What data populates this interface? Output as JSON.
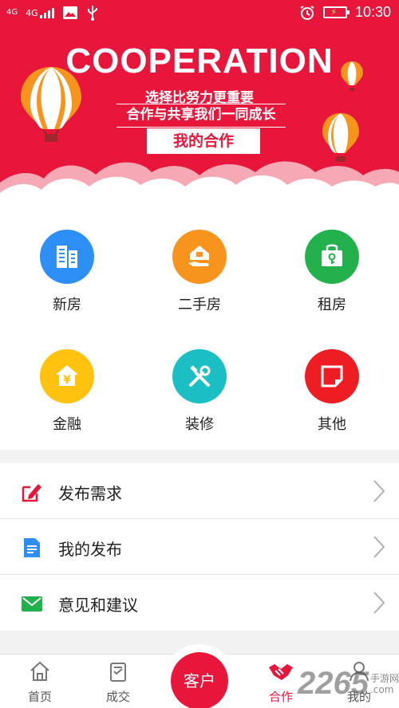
{
  "status_bar": {
    "network_top": "4G",
    "network_main": "4G",
    "time": "10:30",
    "icons": [
      "signal-icon",
      "image-icon",
      "usb-icon",
      "alarm-icon",
      "battery-charging-icon"
    ]
  },
  "banner": {
    "title": "COOPERATION",
    "line1": "选择比努力更重要",
    "line2": "合作与共享我们一同成长",
    "button": "我的合作",
    "background_color": "#e8163b"
  },
  "grid": [
    {
      "label": "新房",
      "icon": "building-icon",
      "color": "#2d8ff3"
    },
    {
      "label": "二手房",
      "icon": "house-hand-icon",
      "color": "#f7941d"
    },
    {
      "label": "租房",
      "icon": "key-bag-icon",
      "color": "#22b14c"
    },
    {
      "label": "金融",
      "icon": "house-yen-icon",
      "color": "#ffc20e"
    },
    {
      "label": "装修",
      "icon": "tools-icon",
      "color": "#1bbec2"
    },
    {
      "label": "其他",
      "icon": "note-icon",
      "color": "#ee1d23"
    }
  ],
  "list": [
    {
      "label": "发布需求",
      "icon": "edit-icon",
      "color": "#e8163b"
    },
    {
      "label": "我的发布",
      "icon": "document-icon",
      "color": "#2d8ff3"
    },
    {
      "label": "意见和建议",
      "icon": "mail-icon",
      "color": "#22b14c"
    }
  ],
  "bottom_nav": {
    "tabs": [
      "首页",
      "成交",
      "合作",
      "我的"
    ],
    "center": "客户",
    "active": "合作"
  },
  "watermark": {
    "number": "2265",
    "suffix": "手游网",
    "domain": ".com"
  }
}
